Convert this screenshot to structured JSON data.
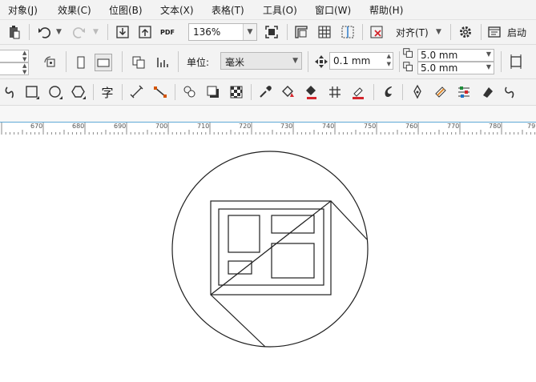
{
  "menu": [
    "对象(J)",
    "效果(C)",
    "位图(B)",
    "文本(X)",
    "表格(T)",
    "工具(O)",
    "窗口(W)",
    "帮助(H)"
  ],
  "toolbar1": {
    "zoom_value": "136%",
    "pdf_label": "PDF",
    "align_label": "对齐(T)",
    "start_label": "启动"
  },
  "toolbar2": {
    "unit_label": "单位:",
    "unit_value": "毫米",
    "nudge_value": "0.1 mm",
    "dup_x_value": "5.0 mm",
    "dup_y_value": "5.0 mm"
  },
  "toolbar3": {
    "text_tool_glyph": "字"
  },
  "ruler": {
    "ticks": [
      "670",
      "680",
      "690",
      "700",
      "710",
      "720",
      "730",
      "740",
      "750",
      "760",
      "770",
      "780",
      "79"
    ]
  },
  "icons": {
    "undo": "undo-icon",
    "redo": "redo-icon",
    "import": "import-icon",
    "export": "export-icon",
    "full_screen": "full-screen-icon",
    "settings": "gear-icon"
  }
}
